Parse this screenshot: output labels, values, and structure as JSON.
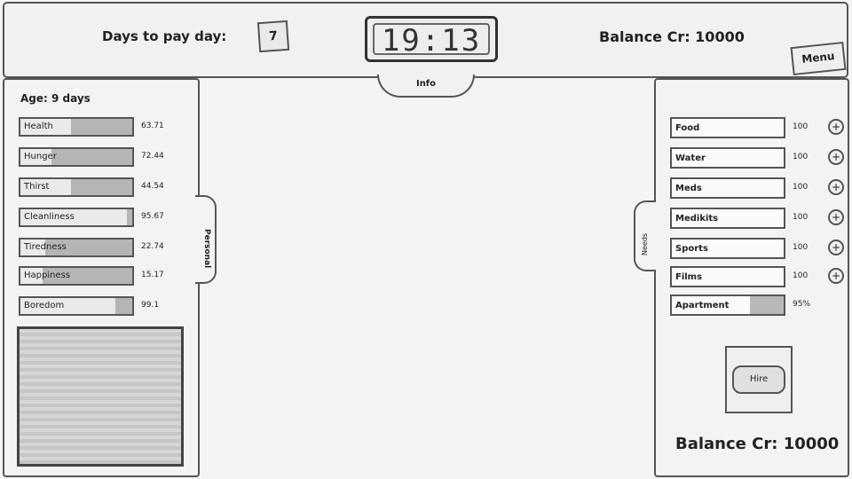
{
  "header": {
    "days_label": "Days to pay day:",
    "days_value": "7",
    "clock": "19:13",
    "balance": "Balance Cr: 10000",
    "menu_label": "Menu",
    "info_tab": "Info"
  },
  "left": {
    "age": "Age: 9 days",
    "tab_label": "Personal",
    "stats": [
      {
        "label": "Health",
        "value": "63.71",
        "fill": 0.55
      },
      {
        "label": "Hunger",
        "value": "72.44",
        "fill": 0.72
      },
      {
        "label": "Thirst",
        "value": "44.54",
        "fill": 0.55
      },
      {
        "label": "Cleanliness",
        "value": "95.67",
        "fill": 0.05
      },
      {
        "label": "Tiredness",
        "value": "22.74",
        "fill": 0.78
      },
      {
        "label": "Happiness",
        "value": "15.17",
        "fill": 0.8
      },
      {
        "label": "Boredom",
        "value": "99.1",
        "fill": 0.15
      }
    ]
  },
  "right": {
    "tab_label": "Needs",
    "needs": [
      {
        "label": "Food",
        "value": "100"
      },
      {
        "label": "Water",
        "value": "100"
      },
      {
        "label": "Meds",
        "value": "100"
      },
      {
        "label": "Medikits",
        "value": "100"
      },
      {
        "label": "Sports",
        "value": "100"
      },
      {
        "label": "Films",
        "value": "100"
      }
    ],
    "appt": {
      "label": "Apartment",
      "value": "95%",
      "fill": 0.3
    },
    "center_button": "Hire",
    "balance": "Balance Cr: 10000"
  }
}
